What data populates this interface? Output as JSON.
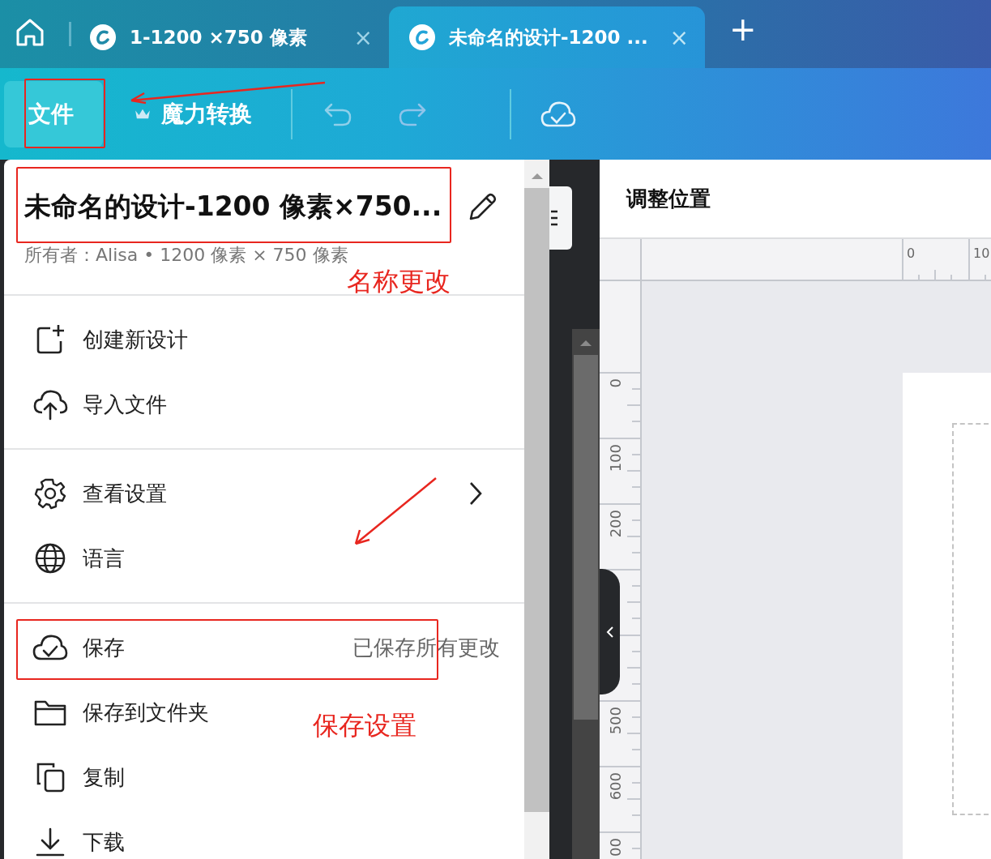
{
  "browser_tabs": [
    {
      "title": "1-1200 ×750 像素",
      "close": "×",
      "selected": false
    },
    {
      "title": "未命名的设计-1200 ...",
      "close": "×",
      "selected": true
    }
  ],
  "new_tab": "+",
  "toolbar": {
    "file_button": {
      "label": "文件",
      "selected": true
    },
    "magic_button": "魔力转换"
  },
  "menu": {
    "title": "未命名的设计-1200 像素×750...",
    "subtitle": "所有者：Alisa • 1200 像素 × 750 像素",
    "groups": [
      [
        {
          "kind": "new-design",
          "label": "创建新设计",
          "submenu": false
        },
        {
          "kind": "upload",
          "label": "导入文件",
          "submenu": false
        }
      ],
      [
        {
          "kind": "settings",
          "label": "查看设置",
          "submenu": true
        },
        {
          "kind": "language",
          "label": "语言",
          "submenu": false
        }
      ],
      [
        {
          "kind": "save",
          "label": "保存",
          "note": "已保存所有更改",
          "submenu": false
        },
        {
          "kind": "folder",
          "label": "保存到文件夹",
          "submenu": false
        },
        {
          "kind": "copy",
          "label": "复制",
          "submenu": false
        },
        {
          "kind": "download",
          "label": "下载",
          "submenu": false
        }
      ]
    ]
  },
  "panel": {
    "title": "调整位置",
    "top_ruler_labels": [
      "0",
      "10"
    ],
    "side_ruler_labels": [
      "0",
      "100",
      "200",
      "500",
      "600",
      "00"
    ]
  },
  "annotations": [
    "名称更改",
    "保存设置"
  ]
}
